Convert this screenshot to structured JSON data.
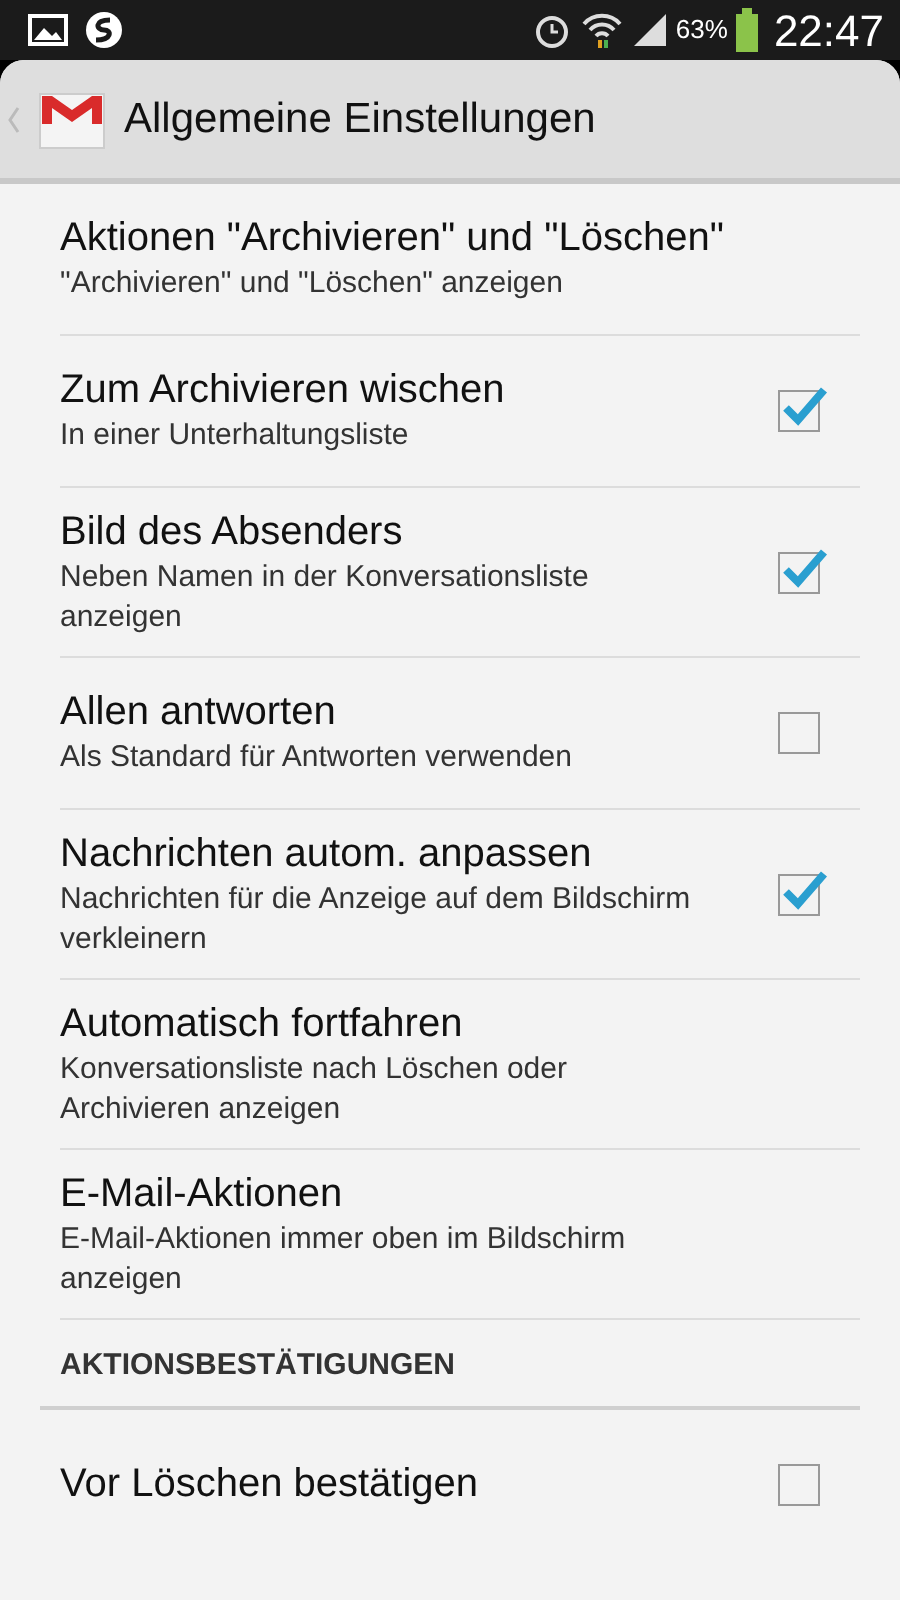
{
  "status_bar": {
    "battery": "63%",
    "time": "22:47"
  },
  "header": {
    "title": "Allgemeine Einstellungen"
  },
  "settings": [
    {
      "kind": "plain",
      "title": "Aktionen \"Archivieren\" und \"Löschen\"",
      "summary": "\"Archivieren\" und \"Löschen\" anzeigen"
    },
    {
      "kind": "checkbox",
      "title": "Zum Archivieren wischen",
      "summary": "In einer Unterhaltungsliste",
      "checked": true
    },
    {
      "kind": "checkbox",
      "title": "Bild des Absenders",
      "summary": "Neben Namen in der Konversationsliste anzeigen",
      "checked": true
    },
    {
      "kind": "checkbox",
      "title": "Allen antworten",
      "summary": "Als Standard für Antworten verwenden",
      "checked": false
    },
    {
      "kind": "checkbox",
      "title": "Nachrichten autom. anpassen",
      "summary": "Nachrichten für die Anzeige auf dem Bildschirm verkleinern",
      "checked": true
    },
    {
      "kind": "plain",
      "title": "Automatisch fortfahren",
      "summary": "Konversationsliste nach Löschen oder Archivieren anzeigen"
    },
    {
      "kind": "plain",
      "title": "E-Mail-Aktionen",
      "summary": "E-Mail-Aktionen immer oben im Bildschirm anzeigen"
    },
    {
      "kind": "section",
      "title": "AKTIONSBESTÄTIGUNGEN"
    },
    {
      "kind": "checkbox",
      "title": "Vor Löschen bestätigen",
      "checked": false
    }
  ]
}
